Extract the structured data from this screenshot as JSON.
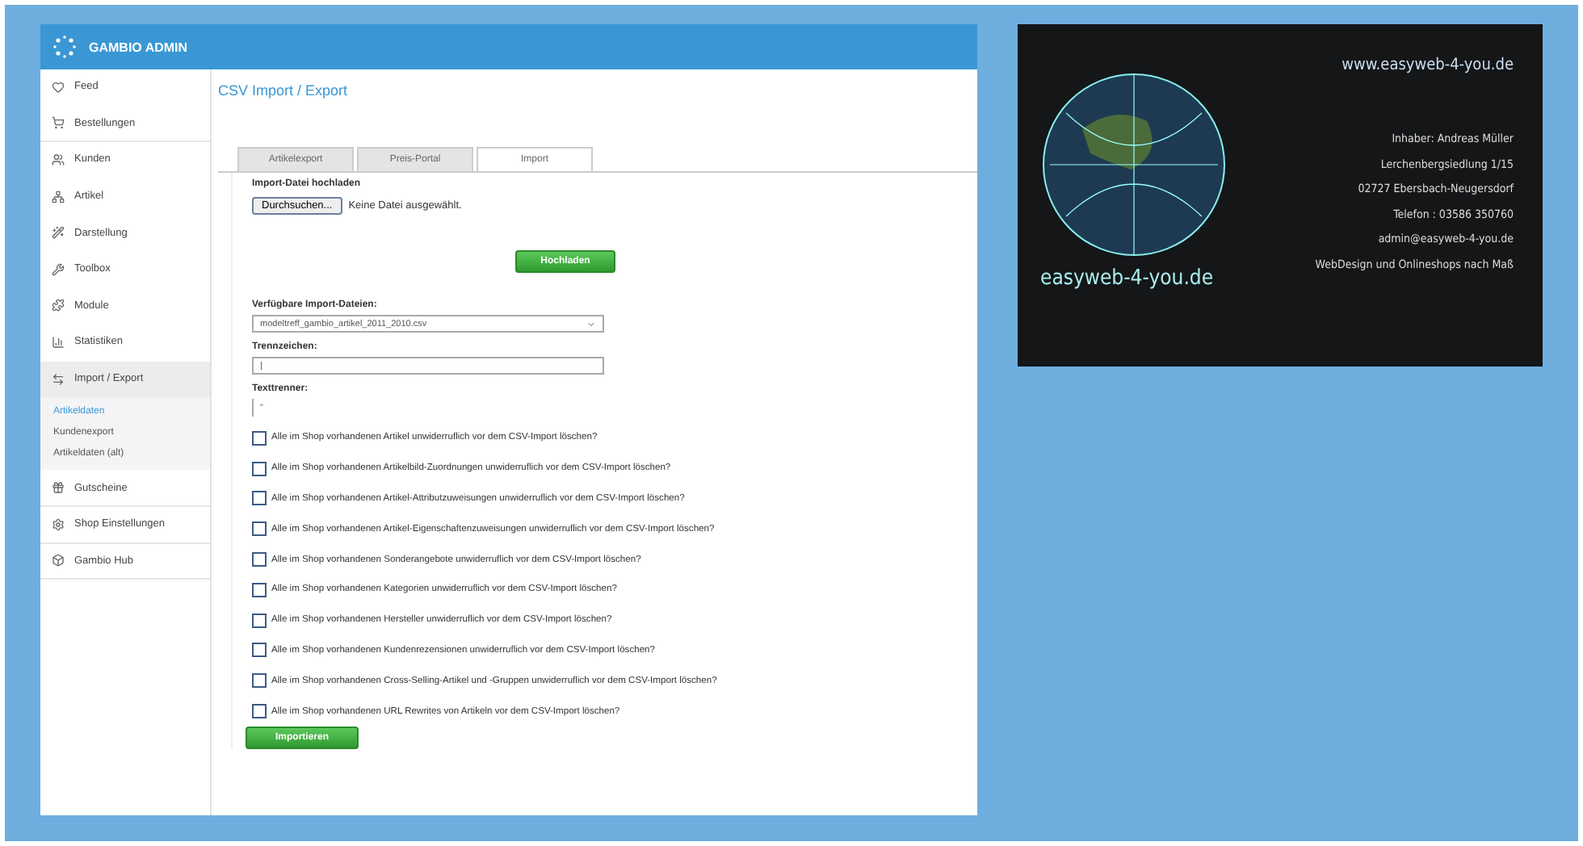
{
  "header": {
    "title": "GAMBIO ADMIN"
  },
  "sidebar": {
    "items": [
      {
        "label": "Feed",
        "selected": false
      },
      {
        "label": "Bestellungen",
        "selected": false
      },
      {
        "label": "Kunden",
        "selected": false
      },
      {
        "label": "Artikel",
        "selected": false
      },
      {
        "label": "Darstellung",
        "selected": false
      },
      {
        "label": "Toolbox",
        "selected": false
      },
      {
        "label": "Module",
        "selected": false
      },
      {
        "label": "Statistiken",
        "selected": false
      },
      {
        "label": "Import / Export",
        "selected": true,
        "children": [
          {
            "label": "Artikeldaten",
            "selected": true
          },
          {
            "label": "Kundenexport",
            "selected": false
          },
          {
            "label": "Artikeldaten (alt)",
            "selected": false
          }
        ]
      },
      {
        "label": "Gutscheine",
        "selected": false
      },
      {
        "label": "Shop Einstellungen",
        "selected": false
      },
      {
        "label": "Gambio Hub",
        "selected": false
      }
    ]
  },
  "content": {
    "title": "CSV Import / Export",
    "tabs": [
      {
        "label": "Artikelexport",
        "selected": false
      },
      {
        "label": "Preis-Portal",
        "selected": false
      },
      {
        "label": "Import",
        "selected": true
      }
    ],
    "upload": {
      "label": "Import-Datei hochladen",
      "browse_button": "Durchsuchen...",
      "file_status": "Keine Datei ausgewählt.",
      "upload_button": "Hochladen"
    },
    "files": {
      "label": "Verfügbare Import-Dateien:",
      "value": "modeltreff_gambio_artikel_2011_2010.csv"
    },
    "separator": {
      "label": "Trennzeichen:",
      "value": "|"
    },
    "text_delimiter": {
      "label": "Texttrenner:",
      "value": "\""
    },
    "options": [
      {
        "label": "Alle im Shop vorhandenen Artikel unwiderruflich vor dem CSV-Import löschen?",
        "checked": false
      },
      {
        "label": "Alle im Shop vorhandenen Artikelbild-Zuordnungen unwiderruflich vor dem CSV-Import löschen?",
        "checked": false
      },
      {
        "label": "Alle im Shop vorhandenen Artikel-Attributzuweisungen unwiderruflich vor dem CSV-Import löschen?",
        "checked": false
      },
      {
        "label": "Alle im Shop vorhandenen Artikel-Eigenschaftenzuweisungen unwiderruflich vor dem CSV-Import löschen?",
        "checked": false
      },
      {
        "label": "Alle im Shop vorhandenen Sonderangebote unwiderruflich vor dem CSV-Import löschen?",
        "checked": false
      },
      {
        "label": "Alle im Shop vorhandenen Kategorien unwiderruflich vor dem CSV-Import löschen?",
        "checked": false
      },
      {
        "label": "Alle im Shop vorhandenen Hersteller unwiderruflich vor dem CSV-Import löschen?",
        "checked": false
      },
      {
        "label": "Alle im Shop vorhandenen Kundenrezensionen unwiderruflich vor dem CSV-Import löschen?",
        "checked": false
      },
      {
        "label": "Alle im Shop vorhandenen Cross-Selling-Artikel und -Gruppen unwiderruflich vor dem CSV-Import löschen?",
        "checked": false
      },
      {
        "label": "Alle im Shop vorhandenen URL Rewrites von Artikeln vor dem CSV-Import löschen?",
        "checked": false
      }
    ],
    "import_button": "Importieren"
  },
  "business_card": {
    "url": "www.easyweb-4-you.de",
    "brand": "easyweb-4-you.de",
    "lines": [
      "Inhaber: Andreas Müller",
      "Lerchenbergsiedlung 1/15",
      "02727 Ebersbach-Neugersdorf",
      "Telefon : 03586 350760",
      "admin@easyweb-4-you.de",
      "WebDesign und Onlineshops nach Maß"
    ]
  }
}
